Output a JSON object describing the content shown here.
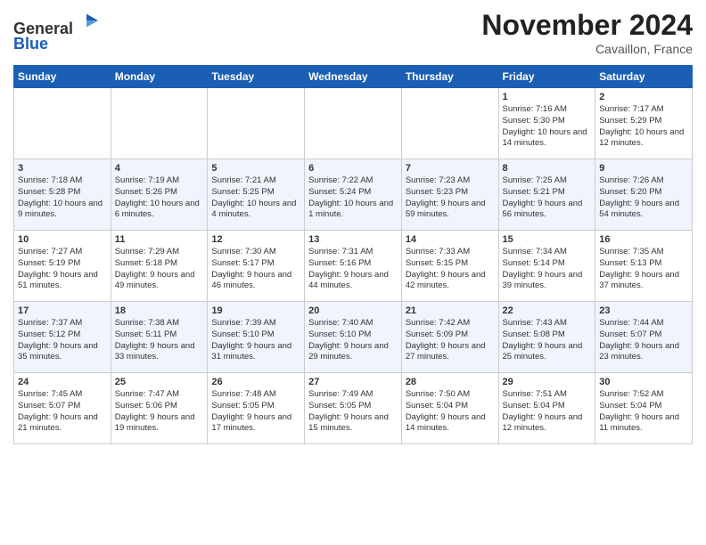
{
  "header": {
    "logo_line1": "General",
    "logo_line2": "Blue",
    "month_title": "November 2024",
    "location": "Cavaillon, France"
  },
  "days_of_week": [
    "Sunday",
    "Monday",
    "Tuesday",
    "Wednesday",
    "Thursday",
    "Friday",
    "Saturday"
  ],
  "weeks": [
    [
      {
        "num": "",
        "info": ""
      },
      {
        "num": "",
        "info": ""
      },
      {
        "num": "",
        "info": ""
      },
      {
        "num": "",
        "info": ""
      },
      {
        "num": "",
        "info": ""
      },
      {
        "num": "1",
        "info": "Sunrise: 7:16 AM\nSunset: 5:30 PM\nDaylight: 10 hours and 14 minutes."
      },
      {
        "num": "2",
        "info": "Sunrise: 7:17 AM\nSunset: 5:29 PM\nDaylight: 10 hours and 12 minutes."
      }
    ],
    [
      {
        "num": "3",
        "info": "Sunrise: 7:18 AM\nSunset: 5:28 PM\nDaylight: 10 hours and 9 minutes."
      },
      {
        "num": "4",
        "info": "Sunrise: 7:19 AM\nSunset: 5:26 PM\nDaylight: 10 hours and 6 minutes."
      },
      {
        "num": "5",
        "info": "Sunrise: 7:21 AM\nSunset: 5:25 PM\nDaylight: 10 hours and 4 minutes."
      },
      {
        "num": "6",
        "info": "Sunrise: 7:22 AM\nSunset: 5:24 PM\nDaylight: 10 hours and 1 minute."
      },
      {
        "num": "7",
        "info": "Sunrise: 7:23 AM\nSunset: 5:23 PM\nDaylight: 9 hours and 59 minutes."
      },
      {
        "num": "8",
        "info": "Sunrise: 7:25 AM\nSunset: 5:21 PM\nDaylight: 9 hours and 56 minutes."
      },
      {
        "num": "9",
        "info": "Sunrise: 7:26 AM\nSunset: 5:20 PM\nDaylight: 9 hours and 54 minutes."
      }
    ],
    [
      {
        "num": "10",
        "info": "Sunrise: 7:27 AM\nSunset: 5:19 PM\nDaylight: 9 hours and 51 minutes."
      },
      {
        "num": "11",
        "info": "Sunrise: 7:29 AM\nSunset: 5:18 PM\nDaylight: 9 hours and 49 minutes."
      },
      {
        "num": "12",
        "info": "Sunrise: 7:30 AM\nSunset: 5:17 PM\nDaylight: 9 hours and 46 minutes."
      },
      {
        "num": "13",
        "info": "Sunrise: 7:31 AM\nSunset: 5:16 PM\nDaylight: 9 hours and 44 minutes."
      },
      {
        "num": "14",
        "info": "Sunrise: 7:33 AM\nSunset: 5:15 PM\nDaylight: 9 hours and 42 minutes."
      },
      {
        "num": "15",
        "info": "Sunrise: 7:34 AM\nSunset: 5:14 PM\nDaylight: 9 hours and 39 minutes."
      },
      {
        "num": "16",
        "info": "Sunrise: 7:35 AM\nSunset: 5:13 PM\nDaylight: 9 hours and 37 minutes."
      }
    ],
    [
      {
        "num": "17",
        "info": "Sunrise: 7:37 AM\nSunset: 5:12 PM\nDaylight: 9 hours and 35 minutes."
      },
      {
        "num": "18",
        "info": "Sunrise: 7:38 AM\nSunset: 5:11 PM\nDaylight: 9 hours and 33 minutes."
      },
      {
        "num": "19",
        "info": "Sunrise: 7:39 AM\nSunset: 5:10 PM\nDaylight: 9 hours and 31 minutes."
      },
      {
        "num": "20",
        "info": "Sunrise: 7:40 AM\nSunset: 5:10 PM\nDaylight: 9 hours and 29 minutes."
      },
      {
        "num": "21",
        "info": "Sunrise: 7:42 AM\nSunset: 5:09 PM\nDaylight: 9 hours and 27 minutes."
      },
      {
        "num": "22",
        "info": "Sunrise: 7:43 AM\nSunset: 5:08 PM\nDaylight: 9 hours and 25 minutes."
      },
      {
        "num": "23",
        "info": "Sunrise: 7:44 AM\nSunset: 5:07 PM\nDaylight: 9 hours and 23 minutes."
      }
    ],
    [
      {
        "num": "24",
        "info": "Sunrise: 7:45 AM\nSunset: 5:07 PM\nDaylight: 9 hours and 21 minutes."
      },
      {
        "num": "25",
        "info": "Sunrise: 7:47 AM\nSunset: 5:06 PM\nDaylight: 9 hours and 19 minutes."
      },
      {
        "num": "26",
        "info": "Sunrise: 7:48 AM\nSunset: 5:05 PM\nDaylight: 9 hours and 17 minutes."
      },
      {
        "num": "27",
        "info": "Sunrise: 7:49 AM\nSunset: 5:05 PM\nDaylight: 9 hours and 15 minutes."
      },
      {
        "num": "28",
        "info": "Sunrise: 7:50 AM\nSunset: 5:04 PM\nDaylight: 9 hours and 14 minutes."
      },
      {
        "num": "29",
        "info": "Sunrise: 7:51 AM\nSunset: 5:04 PM\nDaylight: 9 hours and 12 minutes."
      },
      {
        "num": "30",
        "info": "Sunrise: 7:52 AM\nSunset: 5:04 PM\nDaylight: 9 hours and 11 minutes."
      }
    ]
  ]
}
